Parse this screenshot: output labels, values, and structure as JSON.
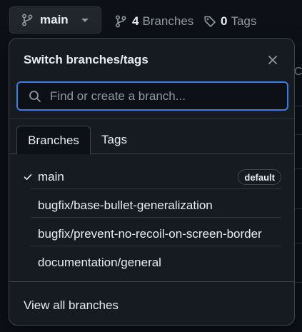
{
  "topbar": {
    "branch_button": {
      "label": "main"
    },
    "branches_link": {
      "count": "4",
      "label": "Branches"
    },
    "tags_link": {
      "count": "0",
      "label": "Tags"
    }
  },
  "background": {
    "partial_text": "Ca"
  },
  "popover": {
    "title": "Switch branches/tags",
    "close_label": "Close",
    "search": {
      "placeholder": "Find or create a branch...",
      "value": ""
    },
    "tabs": [
      {
        "label": "Branches",
        "active": true
      },
      {
        "label": "Tags",
        "active": false
      }
    ],
    "branches": [
      {
        "name": "main",
        "selected": true,
        "badge": "default"
      },
      {
        "name": "bugfix/base-bullet-generalization",
        "selected": false,
        "badge": ""
      },
      {
        "name": "bugfix/prevent-no-recoil-on-screen-border",
        "selected": false,
        "badge": ""
      },
      {
        "name": "documentation/general",
        "selected": false,
        "badge": ""
      }
    ],
    "footer_link": "View all branches"
  },
  "icons": {
    "branch": "git-branch-icon",
    "tag": "tag-icon",
    "caret": "triangle-down-icon",
    "close": "x-icon",
    "search": "search-icon",
    "check": "check-icon"
  },
  "colors": {
    "page_bg": "#0d1117",
    "panel_bg": "#161b22",
    "focus_border": "#3d7ddb",
    "muted_text": "#9198a1",
    "text": "#e6edf3"
  }
}
